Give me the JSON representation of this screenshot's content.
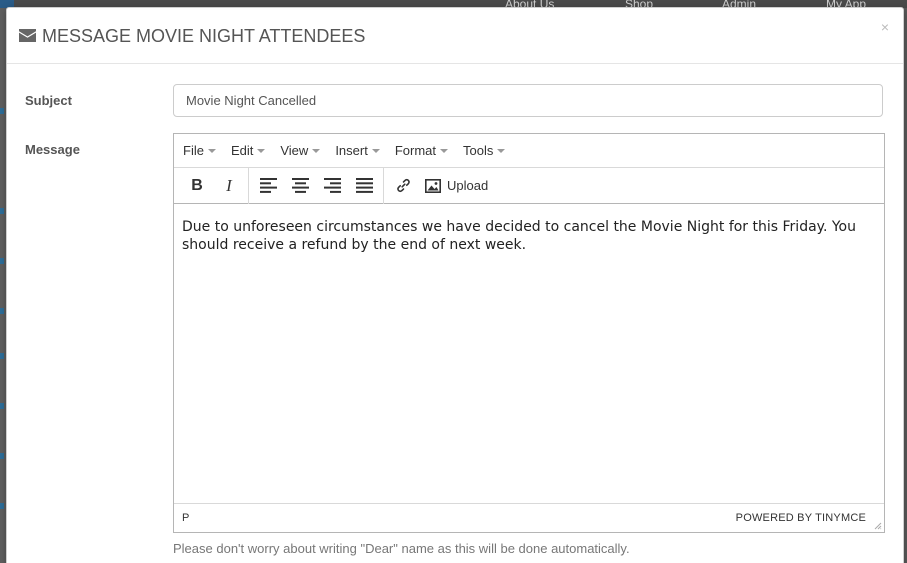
{
  "background": {
    "nav_items": [
      "About Us",
      "Shop",
      "Admin",
      "My App"
    ]
  },
  "modal": {
    "title": "MESSAGE MOVIE NIGHT ATTENDEES",
    "close_symbol": "×",
    "subject_label": "Subject",
    "subject_value": "Movie Night Cancelled",
    "message_label": "Message",
    "help_text": "Please don't worry about writing \"Dear\" name as this will be done automatically."
  },
  "editor": {
    "menus": [
      "File",
      "Edit",
      "View",
      "Insert",
      "Format",
      "Tools"
    ],
    "toolbar": {
      "bold": "B",
      "italic": "I",
      "upload_label": "Upload"
    },
    "content": "Due to unforeseen circumstances we have decided to cancel the Movie Night for this Friday. You should receive a refund by the end of next week.",
    "status_path": "P",
    "powered_by": "POWERED BY TINYMCE"
  },
  "colors": {
    "accent": "#2a5c88",
    "overlay": "#5a5a5a"
  }
}
